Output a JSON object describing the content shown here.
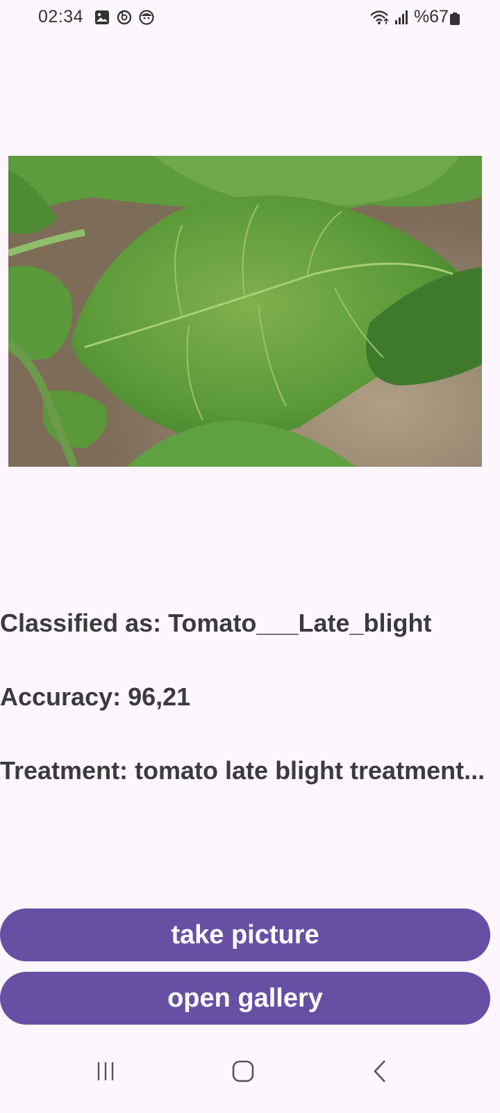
{
  "status_bar": {
    "time": "02:34",
    "battery": "%67",
    "left_icons": [
      "gallery-icon",
      "sync-icon",
      "face-icon"
    ],
    "right_icons": [
      "wifi-icon",
      "signal-icon",
      "battery-icon"
    ]
  },
  "image": {
    "subject": "tomato-leaf-photo"
  },
  "result": {
    "classified": "Classified as: Tomato___Late_blight",
    "accuracy": "Accuracy: 96,21",
    "treatment": "Treatment: tomato late blight treatment..."
  },
  "buttons": {
    "take_picture": "take picture",
    "open_gallery": "open gallery"
  },
  "nav": {
    "items": [
      "recent-apps-icon",
      "home-icon",
      "back-icon"
    ]
  },
  "colors": {
    "background": "#fdf7fd",
    "accent": "#6750a4",
    "text": "#3b3a40"
  }
}
